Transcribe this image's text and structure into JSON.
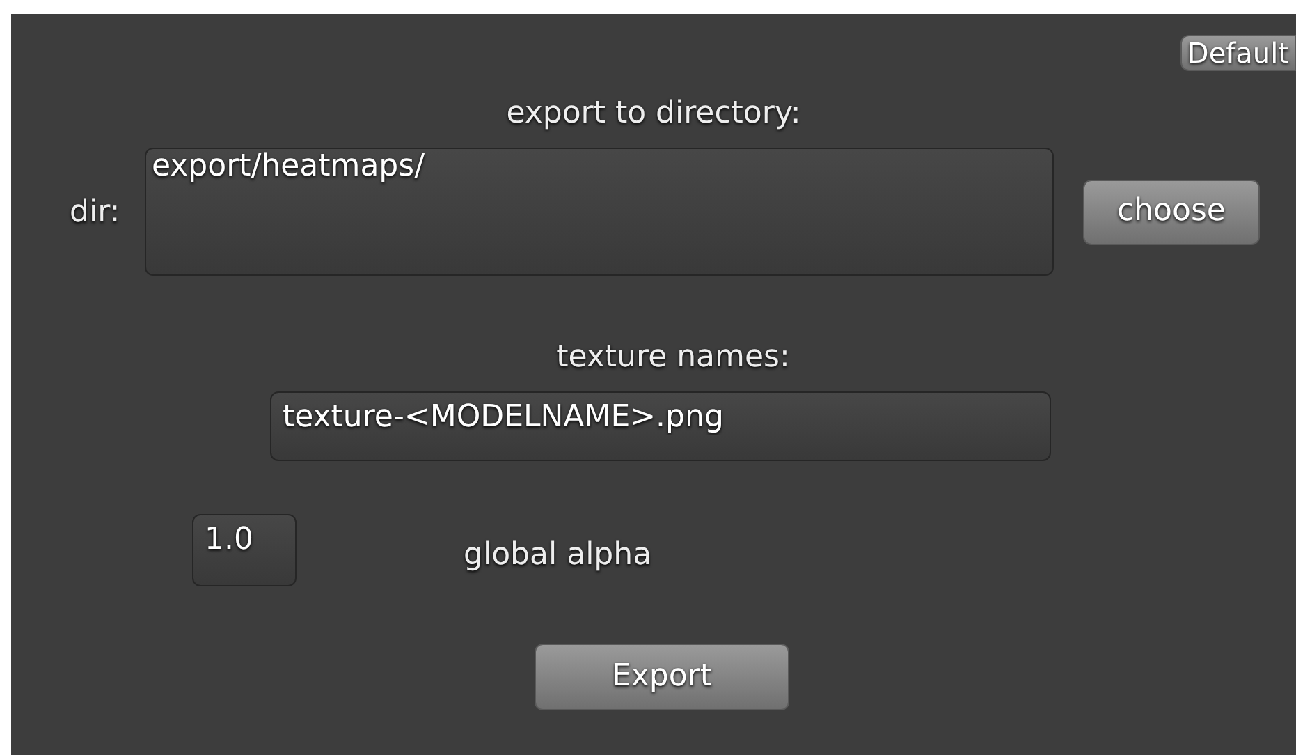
{
  "default_button": "Default",
  "heading": "export to directory:",
  "dir": {
    "label": "dir:",
    "value": "export/heatmaps/",
    "button": "choose"
  },
  "texture": {
    "label": "texture names:",
    "value": "texture-<MODELNAME>.png"
  },
  "alpha": {
    "value": "1.0",
    "label": "global alpha"
  },
  "export_button": "Export"
}
